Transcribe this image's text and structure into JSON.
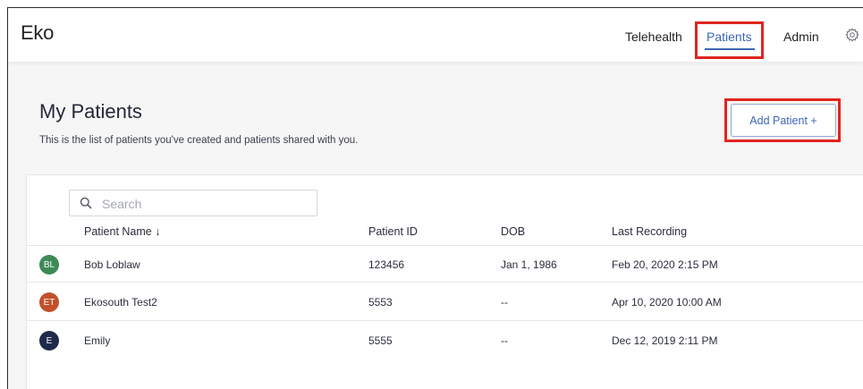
{
  "header": {
    "logo": "Eko",
    "nav": [
      {
        "label": "Telehealth"
      },
      {
        "label": "Patients"
      },
      {
        "label": "Admin"
      }
    ]
  },
  "page": {
    "title": "My Patients",
    "subtitle": "This is the list of patients you've created and patients shared with you.",
    "add_button": "Add Patient +"
  },
  "search": {
    "placeholder": "Search",
    "value": ""
  },
  "table": {
    "columns": [
      "Patient Name ↓",
      "Patient ID",
      "DOB",
      "Last Recording"
    ],
    "rows": [
      {
        "initials": "BL",
        "name": "Bob Loblaw",
        "id": "123456",
        "dob": "Jan 1, 1986",
        "last": "Feb 20, 2020 2:15 PM",
        "color": "#3e8a57"
      },
      {
        "initials": "ET",
        "name": "Ekosouth Test2",
        "id": "5553",
        "dob": "--",
        "last": "Apr 10, 2020 10:00 AM",
        "color": "#c2512b"
      },
      {
        "initials": "E",
        "name": "Emily",
        "id": "5555",
        "dob": "--",
        "last": "Dec 12, 2019 2:11 PM",
        "color": "#1f2a4a"
      }
    ]
  },
  "colors": {
    "accent": "#3d67b8",
    "highlight": "#e0251f"
  }
}
